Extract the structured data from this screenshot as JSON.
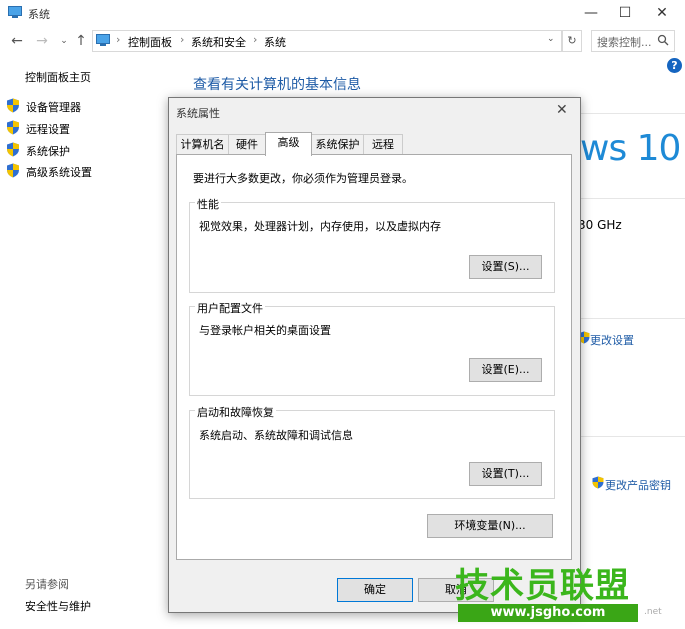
{
  "window": {
    "title": "系统"
  },
  "address": {
    "crumbs": [
      "控制面板",
      "系统和安全",
      "系统"
    ],
    "search_placeholder": "搜索控制..."
  },
  "left_panel": {
    "home": "控制面板主页",
    "items": [
      {
        "label": "设备管理器"
      },
      {
        "label": "远程设置"
      },
      {
        "label": "系统保护"
      },
      {
        "label": "高级系统设置"
      }
    ],
    "see_also": "另请参阅",
    "security_maintenance": "安全性与维护"
  },
  "main": {
    "heading": "查看有关计算机的基本信息",
    "windows_logo_text": "ws 10",
    "processor_speed": "30 GHz",
    "change_settings": "更改设置",
    "change_product_key": "更改产品密钥"
  },
  "dialog": {
    "title": "系统属性",
    "tabs": [
      {
        "label": "计算机名"
      },
      {
        "label": "硬件"
      },
      {
        "label": "高级"
      },
      {
        "label": "系统保护"
      },
      {
        "label": "远程"
      }
    ],
    "active_tab": "高级",
    "admin_note": "要进行大多数更改，你必须作为管理员登录。",
    "performance": {
      "title": "性能",
      "desc": "视觉效果，处理器计划，内存使用，以及虚拟内存",
      "button": "设置(S)..."
    },
    "user_profiles": {
      "title": "用户配置文件",
      "desc": "与登录帐户相关的桌面设置",
      "button": "设置(E)..."
    },
    "startup_recovery": {
      "title": "启动和故障恢复",
      "desc": "系统启动、系统故障和调试信息",
      "button": "设置(T)..."
    },
    "env_vars_button": "环境变量(N)...",
    "ok_button": "确定",
    "cancel_button": "取消"
  },
  "watermark": {
    "brand": "技术员联盟",
    "url": "www.jsgho.com",
    "suffix": ".net"
  },
  "colors": {
    "link": "#1e5ba6",
    "accent": "#0078d7",
    "watermark": "#3bb61c"
  }
}
